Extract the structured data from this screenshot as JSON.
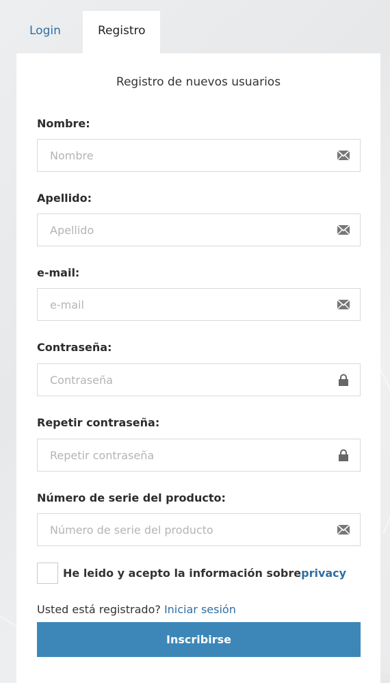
{
  "tabs": {
    "login": "Login",
    "registro": "Registro"
  },
  "form": {
    "title": "Registro de nuevos usuarios",
    "fields": [
      {
        "label": "Nombre:",
        "placeholder": "Nombre",
        "value": "",
        "icon": "envelope-icon"
      },
      {
        "label": "Apellido:",
        "placeholder": "Apellido",
        "value": "",
        "icon": "envelope-icon"
      },
      {
        "label": "e-mail:",
        "placeholder": "e-mail",
        "value": "",
        "icon": "envelope-icon"
      },
      {
        "label": "Contraseña:",
        "placeholder": "Contraseña",
        "value": "",
        "icon": "lock-icon"
      },
      {
        "label": "Repetir contraseña:",
        "placeholder": "Repetir contraseña",
        "value": "",
        "icon": "lock-icon"
      },
      {
        "label": "Número de serie del producto:",
        "placeholder": "Número de serie del producto",
        "value": "",
        "icon": "envelope-icon"
      }
    ],
    "consent": {
      "checked": false,
      "text": "He leido y acepto la información sobre",
      "link": "privacy"
    },
    "registered": {
      "text": "Usted está registrado? ",
      "link": "Iniciar sesión"
    },
    "submit_label": "Inscribirse"
  },
  "colors": {
    "accent": "#3d87b8",
    "link": "#2f6ea3",
    "background": "#e9ebed"
  }
}
